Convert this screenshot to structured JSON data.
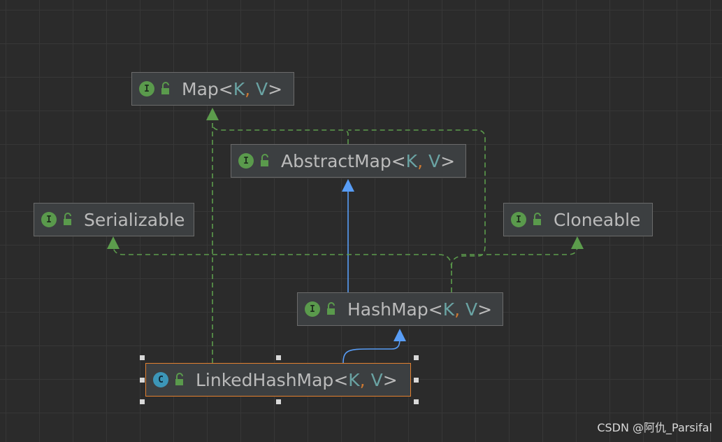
{
  "diagram": {
    "nodes": [
      {
        "id": "map",
        "kind": "interface",
        "kind_badge": "I",
        "name": "Map",
        "type_params": [
          "K",
          "V"
        ]
      },
      {
        "id": "abstractmap",
        "kind": "interface",
        "kind_badge": "I",
        "name": "AbstractMap",
        "type_params": [
          "K",
          "V"
        ]
      },
      {
        "id": "serializable",
        "kind": "interface",
        "kind_badge": "I",
        "name": "Serializable",
        "type_params": []
      },
      {
        "id": "cloneable",
        "kind": "interface",
        "kind_badge": "I",
        "name": "Cloneable",
        "type_params": []
      },
      {
        "id": "hashmap",
        "kind": "interface",
        "kind_badge": "I",
        "name": "HashMap",
        "type_params": [
          "K",
          "V"
        ]
      },
      {
        "id": "linkedhashmap",
        "kind": "class",
        "kind_badge": "C",
        "name": "LinkedHashMap",
        "type_params": [
          "K",
          "V"
        ],
        "selected": true
      }
    ],
    "edges": [
      {
        "from": "hashmap",
        "to": "abstractmap",
        "type": "extends"
      },
      {
        "from": "linkedhashmap",
        "to": "hashmap",
        "type": "extends"
      },
      {
        "from": "linkedhashmap",
        "to": "map",
        "type": "implements"
      },
      {
        "from": "abstractmap",
        "to": "map",
        "type": "implements"
      },
      {
        "from": "hashmap",
        "to": "map",
        "type": "implements"
      },
      {
        "from": "hashmap",
        "to": "serializable",
        "type": "implements"
      },
      {
        "from": "hashmap",
        "to": "cloneable",
        "type": "implements"
      }
    ]
  },
  "colors": {
    "background": "#2b2b2b",
    "extends_edge": "#589df6",
    "implements_edge": "#5c9c4c",
    "selection": "#e3802f",
    "type_param": "#6aa3a3",
    "separator": "#cc7832"
  },
  "watermark": "CSDN @阿仇_Parsifal"
}
